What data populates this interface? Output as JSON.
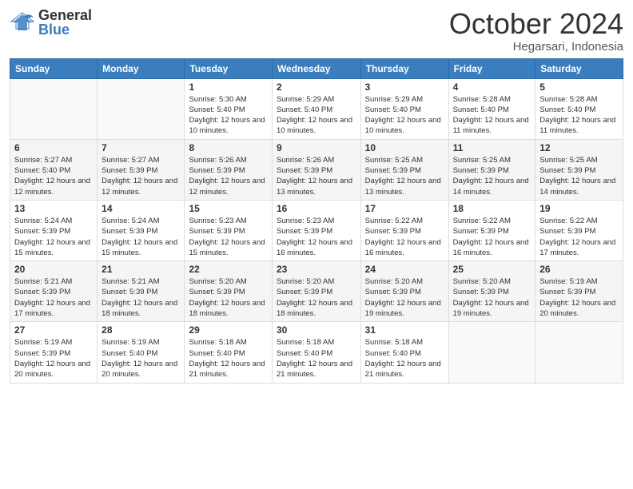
{
  "header": {
    "logo_general": "General",
    "logo_blue": "Blue",
    "month_year": "October 2024",
    "location": "Hegarsari, Indonesia"
  },
  "days_of_week": [
    "Sunday",
    "Monday",
    "Tuesday",
    "Wednesday",
    "Thursday",
    "Friday",
    "Saturday"
  ],
  "weeks": [
    [
      {
        "day": "",
        "info": ""
      },
      {
        "day": "",
        "info": ""
      },
      {
        "day": "1",
        "info": "Sunrise: 5:30 AM\nSunset: 5:40 PM\nDaylight: 12 hours and 10 minutes."
      },
      {
        "day": "2",
        "info": "Sunrise: 5:29 AM\nSunset: 5:40 PM\nDaylight: 12 hours and 10 minutes."
      },
      {
        "day": "3",
        "info": "Sunrise: 5:29 AM\nSunset: 5:40 PM\nDaylight: 12 hours and 10 minutes."
      },
      {
        "day": "4",
        "info": "Sunrise: 5:28 AM\nSunset: 5:40 PM\nDaylight: 12 hours and 11 minutes."
      },
      {
        "day": "5",
        "info": "Sunrise: 5:28 AM\nSunset: 5:40 PM\nDaylight: 12 hours and 11 minutes."
      }
    ],
    [
      {
        "day": "6",
        "info": "Sunrise: 5:27 AM\nSunset: 5:40 PM\nDaylight: 12 hours and 12 minutes."
      },
      {
        "day": "7",
        "info": "Sunrise: 5:27 AM\nSunset: 5:39 PM\nDaylight: 12 hours and 12 minutes."
      },
      {
        "day": "8",
        "info": "Sunrise: 5:26 AM\nSunset: 5:39 PM\nDaylight: 12 hours and 12 minutes."
      },
      {
        "day": "9",
        "info": "Sunrise: 5:26 AM\nSunset: 5:39 PM\nDaylight: 12 hours and 13 minutes."
      },
      {
        "day": "10",
        "info": "Sunrise: 5:25 AM\nSunset: 5:39 PM\nDaylight: 12 hours and 13 minutes."
      },
      {
        "day": "11",
        "info": "Sunrise: 5:25 AM\nSunset: 5:39 PM\nDaylight: 12 hours and 14 minutes."
      },
      {
        "day": "12",
        "info": "Sunrise: 5:25 AM\nSunset: 5:39 PM\nDaylight: 12 hours and 14 minutes."
      }
    ],
    [
      {
        "day": "13",
        "info": "Sunrise: 5:24 AM\nSunset: 5:39 PM\nDaylight: 12 hours and 15 minutes."
      },
      {
        "day": "14",
        "info": "Sunrise: 5:24 AM\nSunset: 5:39 PM\nDaylight: 12 hours and 15 minutes."
      },
      {
        "day": "15",
        "info": "Sunrise: 5:23 AM\nSunset: 5:39 PM\nDaylight: 12 hours and 15 minutes."
      },
      {
        "day": "16",
        "info": "Sunrise: 5:23 AM\nSunset: 5:39 PM\nDaylight: 12 hours and 16 minutes."
      },
      {
        "day": "17",
        "info": "Sunrise: 5:22 AM\nSunset: 5:39 PM\nDaylight: 12 hours and 16 minutes."
      },
      {
        "day": "18",
        "info": "Sunrise: 5:22 AM\nSunset: 5:39 PM\nDaylight: 12 hours and 16 minutes."
      },
      {
        "day": "19",
        "info": "Sunrise: 5:22 AM\nSunset: 5:39 PM\nDaylight: 12 hours and 17 minutes."
      }
    ],
    [
      {
        "day": "20",
        "info": "Sunrise: 5:21 AM\nSunset: 5:39 PM\nDaylight: 12 hours and 17 minutes."
      },
      {
        "day": "21",
        "info": "Sunrise: 5:21 AM\nSunset: 5:39 PM\nDaylight: 12 hours and 18 minutes."
      },
      {
        "day": "22",
        "info": "Sunrise: 5:20 AM\nSunset: 5:39 PM\nDaylight: 12 hours and 18 minutes."
      },
      {
        "day": "23",
        "info": "Sunrise: 5:20 AM\nSunset: 5:39 PM\nDaylight: 12 hours and 18 minutes."
      },
      {
        "day": "24",
        "info": "Sunrise: 5:20 AM\nSunset: 5:39 PM\nDaylight: 12 hours and 19 minutes."
      },
      {
        "day": "25",
        "info": "Sunrise: 5:20 AM\nSunset: 5:39 PM\nDaylight: 12 hours and 19 minutes."
      },
      {
        "day": "26",
        "info": "Sunrise: 5:19 AM\nSunset: 5:39 PM\nDaylight: 12 hours and 20 minutes."
      }
    ],
    [
      {
        "day": "27",
        "info": "Sunrise: 5:19 AM\nSunset: 5:39 PM\nDaylight: 12 hours and 20 minutes."
      },
      {
        "day": "28",
        "info": "Sunrise: 5:19 AM\nSunset: 5:40 PM\nDaylight: 12 hours and 20 minutes."
      },
      {
        "day": "29",
        "info": "Sunrise: 5:18 AM\nSunset: 5:40 PM\nDaylight: 12 hours and 21 minutes."
      },
      {
        "day": "30",
        "info": "Sunrise: 5:18 AM\nSunset: 5:40 PM\nDaylight: 12 hours and 21 minutes."
      },
      {
        "day": "31",
        "info": "Sunrise: 5:18 AM\nSunset: 5:40 PM\nDaylight: 12 hours and 21 minutes."
      },
      {
        "day": "",
        "info": ""
      },
      {
        "day": "",
        "info": ""
      }
    ]
  ]
}
